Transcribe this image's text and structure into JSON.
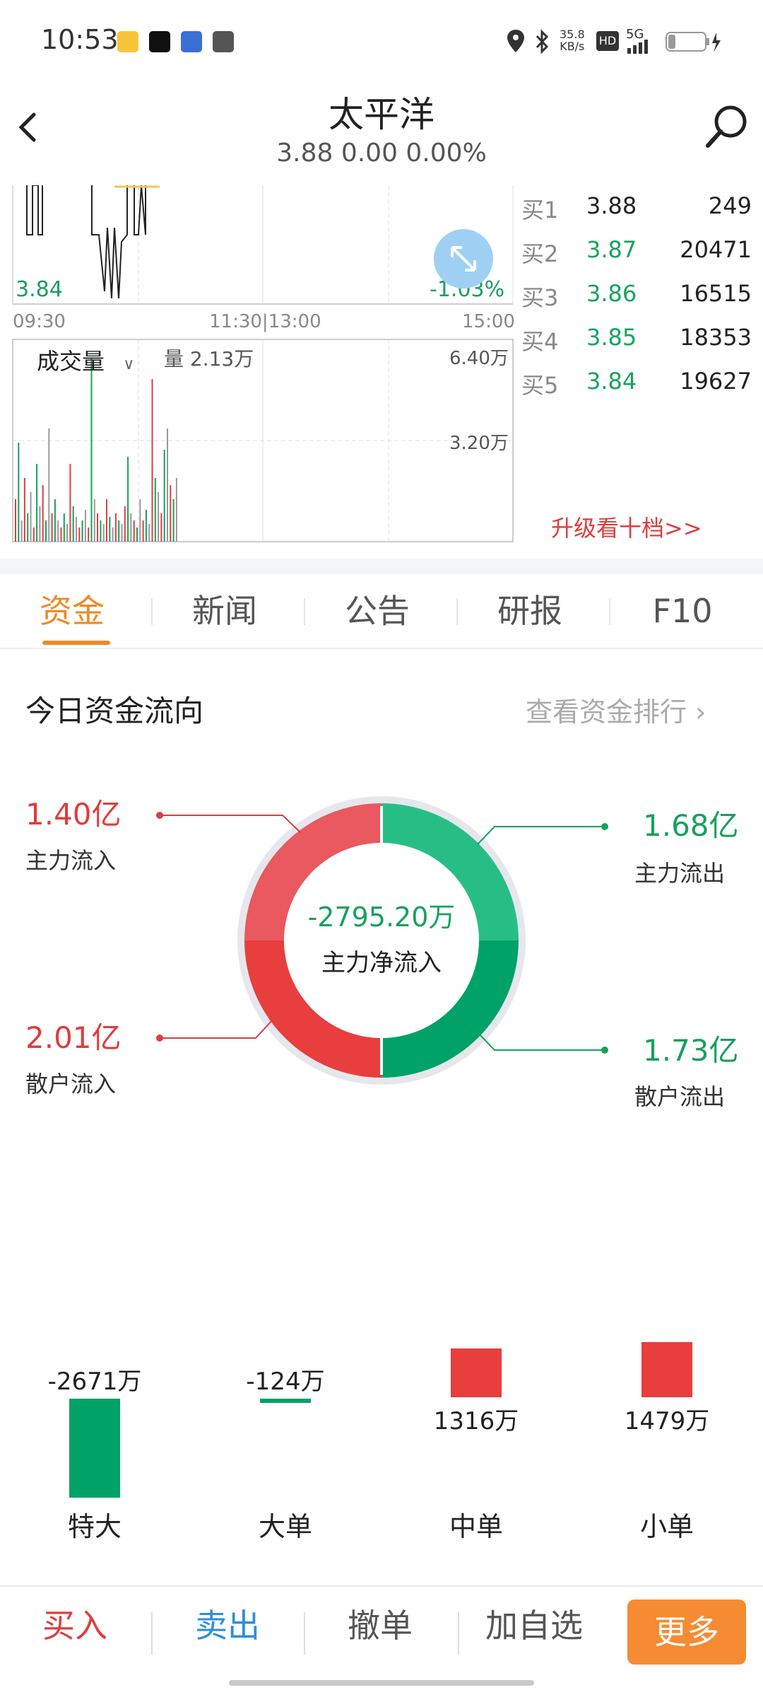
{
  "status_bar": {
    "time": "10:53",
    "net_speed_value": "35.8",
    "net_speed_unit": "KB/s",
    "hd": "HD",
    "signal": "5G"
  },
  "header": {
    "title": "太平洋",
    "subtitle": "3.88 0.00 0.00%"
  },
  "intraday": {
    "low_price": "3.84",
    "low_pct": "-1.03%",
    "times": [
      "09:30",
      "11:30|13:00",
      "15:00"
    ],
    "volume_selector": "成交量",
    "volume_label": "量 2.13万",
    "volume_max": "6.40万",
    "volume_mid": "3.20万"
  },
  "order_book": {
    "rows": [
      {
        "label": "买1",
        "price": "3.88",
        "volume": "249"
      },
      {
        "label": "买2",
        "price": "3.87",
        "volume": "20471"
      },
      {
        "label": "买3",
        "price": "3.86",
        "volume": "16515"
      },
      {
        "label": "买4",
        "price": "3.85",
        "volume": "18353"
      },
      {
        "label": "买5",
        "price": "3.84",
        "volume": "19627"
      }
    ],
    "upgrade_link": "升级看十档>>"
  },
  "tabs": [
    {
      "label": "资金"
    },
    {
      "label": "新闻"
    },
    {
      "label": "公告"
    },
    {
      "label": "研报"
    },
    {
      "label": "F10"
    }
  ],
  "fund_flow": {
    "title": "今日资金流向",
    "ranking_link": "查看资金排行",
    "main_in_value": "1.40亿",
    "main_in_label": "主力流入",
    "retail_in_value": "2.01亿",
    "retail_in_label": "散户流入",
    "main_out_value": "1.68亿",
    "main_out_label": "主力流出",
    "retail_out_value": "1.73亿",
    "retail_out_label": "散户流出",
    "net_value": "-2795.20万",
    "net_label": "主力净流入",
    "colors": {
      "in_main": "#e9595f",
      "in_retail": "#e83e3e",
      "out_main": "#27be86",
      "out_retail": "#00a268"
    }
  },
  "order_size": {
    "bars": [
      {
        "label": "特大",
        "value_text": "-2671万",
        "value": -2671
      },
      {
        "label": "大单",
        "value_text": "-124万",
        "value": -124
      },
      {
        "label": "中单",
        "value_text": "1316万",
        "value": 1316
      },
      {
        "label": "小单",
        "value_text": "1479万",
        "value": 1479
      }
    ]
  },
  "bottom_bar": {
    "buy": "买入",
    "sell": "卖出",
    "cancel": "撤单",
    "add_watch": "加自选",
    "more": "更多"
  }
}
